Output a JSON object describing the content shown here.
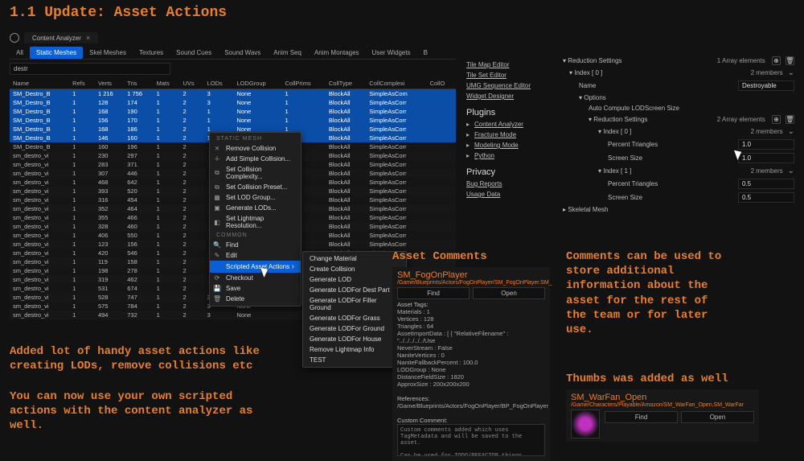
{
  "title": "1.1 Update: Asset Actions",
  "tab": {
    "name": "Content Analyzer"
  },
  "filters": [
    "All",
    "Static Meshes",
    "Skel Meshes",
    "Textures",
    "Sound Cues",
    "Sound Wavs",
    "Anim Seq",
    "Anim Montages",
    "User Widgets",
    "B"
  ],
  "filters_active": 1,
  "search": "destr",
  "columns": [
    "Name",
    "Refs",
    "Verts",
    "Tris",
    "Mats",
    "UVs",
    "LODs",
    "LODGroup",
    "CollPrims",
    "CollType",
    "CollComplexi",
    "CollO"
  ],
  "rows": [
    {
      "sel": true,
      "c": [
        "SM_Destro_B",
        "1",
        "1 216",
        "1 756",
        "1",
        "2",
        "3",
        "None",
        "1",
        "BlockAll",
        "SimpleAsCom",
        ""
      ]
    },
    {
      "sel": true,
      "c": [
        "SM_Destro_B",
        "1",
        "128",
        "174",
        "1",
        "2",
        "3",
        "None",
        "1",
        "BlockAll",
        "SimpleAsCorr",
        ""
      ]
    },
    {
      "sel": true,
      "c": [
        "SM_Destro_B",
        "1",
        "168",
        "190",
        "1",
        "2",
        "1",
        "None",
        "1",
        "BlockAll",
        "SimpleAsCorr",
        ""
      ]
    },
    {
      "sel": true,
      "c": [
        "SM_Destro_B",
        "1",
        "156",
        "170",
        "1",
        "2",
        "1",
        "None",
        "1",
        "BlockAll",
        "SimpleAsCorr",
        ""
      ]
    },
    {
      "sel": true,
      "c": [
        "SM_Destro_B",
        "1",
        "168",
        "186",
        "1",
        "2",
        "1",
        "None",
        "1",
        "BlockAll",
        "SimpleAsCorr",
        ""
      ]
    },
    {
      "sel": true,
      "c": [
        "SM_Destro_B",
        "1",
        "146",
        "160",
        "1",
        "2",
        "1",
        "None",
        "1",
        "BlockAll",
        "SimpleAsCorr",
        ""
      ]
    },
    {
      "sel": false,
      "c": [
        "SM_Destro_B",
        "1",
        "160",
        "196",
        "1",
        "2",
        "",
        "",
        "",
        "BlockAll",
        "SimpleAsCorr",
        ""
      ]
    },
    {
      "sel": false,
      "c": [
        "sm_destro_vi",
        "1",
        "230",
        "297",
        "1",
        "2",
        "",
        "",
        "",
        "BlockAll",
        "SimpleAsCorr",
        ""
      ]
    },
    {
      "sel": false,
      "c": [
        "sm_destro_vi",
        "1",
        "283",
        "371",
        "1",
        "2",
        "",
        "",
        "",
        "BlockAll",
        "SimpleAsCorr",
        ""
      ]
    },
    {
      "sel": false,
      "c": [
        "sm_destro_vi",
        "1",
        "307",
        "446",
        "1",
        "2",
        "",
        "",
        "",
        "BlockAll",
        "SimpleAsCorr",
        ""
      ]
    },
    {
      "sel": false,
      "c": [
        "sm_destro_vi",
        "1",
        "468",
        "642",
        "1",
        "2",
        "",
        "",
        "",
        "BlockAll",
        "SimpleAsCorr",
        ""
      ]
    },
    {
      "sel": false,
      "c": [
        "sm_destro_vi",
        "1",
        "393",
        "520",
        "1",
        "2",
        "",
        "",
        "",
        "BlockAll",
        "SimpleAsCorr",
        ""
      ]
    },
    {
      "sel": false,
      "c": [
        "sm_destro_vi",
        "1",
        "316",
        "454",
        "1",
        "2",
        "",
        "",
        "",
        "BlockAll",
        "SimpleAsCorr",
        ""
      ]
    },
    {
      "sel": false,
      "c": [
        "sm_destro_vi",
        "1",
        "352",
        "464",
        "1",
        "2",
        "",
        "",
        "",
        "BlockAll",
        "SimpleAsCorr",
        ""
      ]
    },
    {
      "sel": false,
      "c": [
        "sm_destro_vi",
        "1",
        "355",
        "466",
        "1",
        "2",
        "",
        "",
        "",
        "BlockAll",
        "SimpleAsCorr",
        ""
      ]
    },
    {
      "sel": false,
      "c": [
        "sm_destro_vi",
        "1",
        "328",
        "460",
        "1",
        "2",
        "",
        "",
        "",
        "BlockAll",
        "SimpleAsCorr",
        ""
      ]
    },
    {
      "sel": false,
      "c": [
        "sm_destro_vi",
        "1",
        "406",
        "550",
        "1",
        "2",
        "",
        "",
        "",
        "BlockAll",
        "SimpleAsCorr",
        ""
      ]
    },
    {
      "sel": false,
      "c": [
        "sm_destro_vi",
        "1",
        "123",
        "156",
        "1",
        "2",
        "",
        "",
        "",
        "BlockAll",
        "SimpleAsCorr",
        ""
      ]
    },
    {
      "sel": false,
      "c": [
        "sm_destro_vi",
        "1",
        "420",
        "546",
        "1",
        "2",
        "",
        "",
        "",
        "BlockAll",
        "SimpleAsCorr",
        ""
      ]
    },
    {
      "sel": false,
      "c": [
        "sm_destro_vi",
        "1",
        "119",
        "158",
        "1",
        "2",
        "",
        "",
        "",
        "",
        "",
        ""
      ]
    },
    {
      "sel": false,
      "c": [
        "sm_destro_vi",
        "1",
        "198",
        "278",
        "1",
        "2",
        "",
        "",
        "",
        "",
        "",
        ""
      ]
    },
    {
      "sel": false,
      "c": [
        "sm_destro_vi",
        "1",
        "319",
        "462",
        "1",
        "2",
        "",
        "",
        "",
        "",
        "",
        ""
      ]
    },
    {
      "sel": false,
      "c": [
        "sm_destro_vi",
        "1",
        "531",
        "674",
        "1",
        "2",
        "",
        "",
        "",
        "",
        "",
        ""
      ]
    },
    {
      "sel": false,
      "c": [
        "sm_destro_vi",
        "1",
        "528",
        "747",
        "1",
        "2",
        "3",
        "None",
        "",
        "",
        "",
        ""
      ]
    },
    {
      "sel": false,
      "c": [
        "sm_destro_vi",
        "1",
        "575",
        "784",
        "1",
        "2",
        "3",
        "None",
        "",
        "",
        "",
        ""
      ]
    },
    {
      "sel": false,
      "c": [
        "sm_destro_vi",
        "1",
        "494",
        "732",
        "1",
        "2",
        "3",
        "None",
        "",
        "",
        "",
        ""
      ]
    }
  ],
  "ctx1": {
    "header": "STATIC MESH",
    "items": [
      "Remove Collision",
      "Add Simple Collision...",
      "Set Collision Complexity...",
      "Set Collision Preset...",
      "Set LOD Group...",
      "Generate LODs...",
      "Set Lightmap Resolution..."
    ],
    "header2": "COMMON",
    "items2": [
      "Find",
      "Edit",
      "Scripted Asset Actions",
      "Checkout",
      "Save",
      "Delete"
    ],
    "sel": 2
  },
  "ctx2": {
    "items": [
      "Change Material",
      "Create Collision",
      "Generate LOD",
      "Generate LODFor Dest Part",
      "Generate LODFor Filler Ground",
      "Generate LODFor Grass",
      "Generate LODFor Ground",
      "Generate LODFor House",
      "Remove Lightmap Info",
      "TEST"
    ]
  },
  "links": {
    "a": [
      "Tile Map Editor",
      "Tile Set Editor",
      "UMG Sequence Editor",
      "Widget Designer"
    ],
    "plugins": [
      "Content Analyzer",
      "Fracture Mode",
      "Modeling Mode",
      "Python"
    ],
    "privacy": [
      "Bug Reports",
      "Usage Data"
    ]
  },
  "reduction": {
    "title": "Reduction Settings",
    "arr": "1 Array elements",
    "idx0": "Index [ 0 ]",
    "mem2": "2 members",
    "name_lbl": "Name",
    "name_val": "Destroyable",
    "opt": "Options",
    "auto": "Auto Compute LODScreen Size",
    "rs": "Reduction Settings",
    "arr2": "2 Array elements",
    "idx0b": "Index [ 0 ]",
    "pt": "Percent Triangles",
    "pt_v": "1.0",
    "ss": "Screen Size",
    "ss_v": "1.0",
    "idx1": "Index [ 1 ]",
    "pt2_v": "0.5",
    "ss2_v": "0.5",
    "skel": "Skeletal Mesh"
  },
  "captions": {
    "c1": "Added lot of handy asset actions like\ncreating LODs, remove collisions etc",
    "c2": "You can now use your own scripted\nactions with the content analyzer as\nwell.",
    "c3": "Asset Comments",
    "c4": "Comments can be used to\nstore additional\ninformation about the\nasset for the rest of\nthe team or for later\nuse.",
    "c5": "Thumbs was added as well"
  },
  "comments": {
    "name": "SM_FogOnPlayer",
    "path": "/Game/Blueprints/Actors/FogOnPlayer/SM_FogOnPlayer.SM_",
    "find": "Find",
    "open": "Open",
    "tags_hdr": "Asset Tags:",
    "tags": [
      "Materials  :  1",
      "Vertices  :  128",
      "Triangles  :  64",
      "AssetImportData  :  [ { \"RelativeFilename\" : \"../../../../../Use",
      "NeverStream  :  False",
      "NaniteVertices  :  0",
      "NaniteFallbackPercent  :  100.0",
      "LODGroup  :  None",
      "DistanceFieldSize  :  1820",
      "ApproxSize  :  200x200x200"
    ],
    "refs_hdr": "References:",
    "refs": "/Game/Blueprints/Actors/FogOnPlayer/BP_FogOnPlayer",
    "cc_hdr": "Custom Comment:",
    "cc": "Custom comments added which uses TagMetadata and will be saved to the asset.\n\nCan be used for TODO/REFACTOR things."
  },
  "thumb": {
    "name": "SM_WarFan_Open",
    "path": "/Game/Characters/Playable/Amazon/SM_WarFan_Open.SM_WarFar",
    "find": "Find",
    "open": "Open"
  }
}
